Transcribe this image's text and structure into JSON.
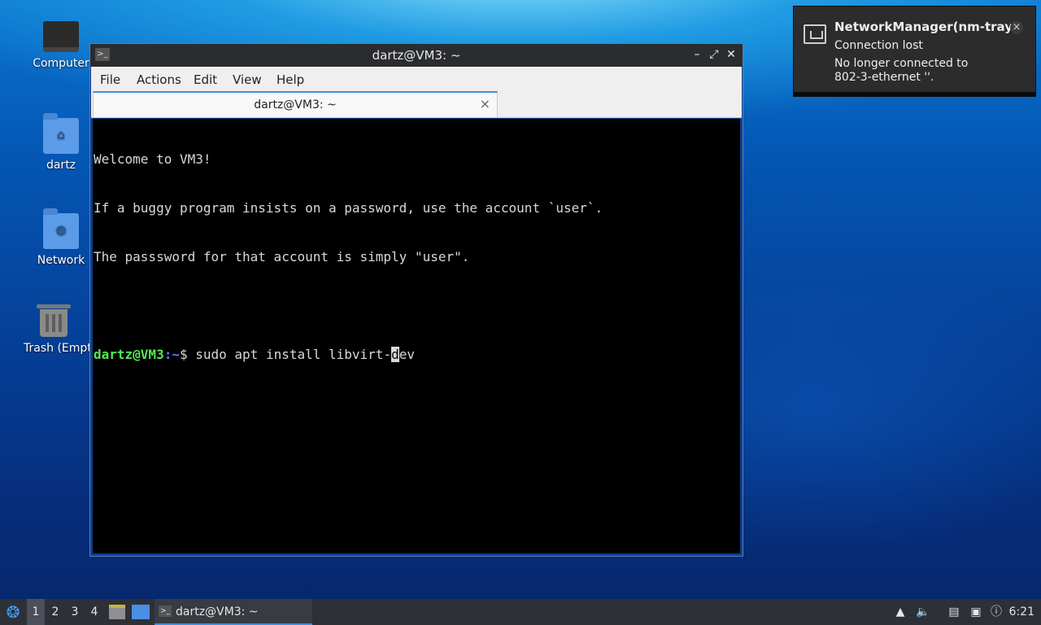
{
  "desktop": {
    "icons": [
      {
        "label": "Computer",
        "icon": "computer-icon"
      },
      {
        "label": "dartz",
        "icon": "home-folder-icon"
      },
      {
        "label": "Network",
        "icon": "network-folder-icon"
      },
      {
        "label": "Trash (Empt",
        "icon": "trash-icon"
      }
    ]
  },
  "window": {
    "title": "dartz@VM3: ~",
    "menu": [
      "File",
      "Actions",
      "Edit",
      "View",
      "Help"
    ],
    "tab": {
      "label": "dartz@VM3: ~",
      "close": "×"
    },
    "terminal": {
      "lines": [
        "Welcome to VM3!",
        "If a buggy program insists on a password, use the account `user`.",
        "The passsword for that account is simply \"user\"."
      ],
      "prompt_user": "dartz@VM3",
      "prompt_sep": ":",
      "prompt_path": "~",
      "prompt_symbol": "$ ",
      "command_before_cursor": "sudo apt install libvirt-",
      "cursor_char": "d",
      "command_after_cursor": "ev"
    },
    "controls": {
      "minimize": "–",
      "maximize": "⤢",
      "close": "✕"
    }
  },
  "notification": {
    "app": "NetworkManager(nm-tray)",
    "summary": "Connection lost",
    "body": "No longer connected to\n802-3-ethernet ''.",
    "close": "×"
  },
  "taskbar": {
    "desktops": [
      "1",
      "2",
      "3",
      "4"
    ],
    "active_desktop": "1",
    "task_label": "dartz@VM3: ~",
    "clock": "6:21"
  }
}
